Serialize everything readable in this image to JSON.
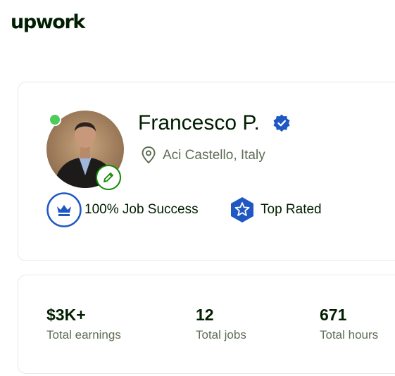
{
  "header": {
    "logo_text": "upwork"
  },
  "profile": {
    "name": "Francesco P.",
    "location": "Aci Castello, Italy",
    "online": true,
    "verified": true,
    "badges": [
      {
        "label": "100% Job Success",
        "icon": "crown-icon",
        "color": "#1f57c3"
      },
      {
        "label": "Top Rated",
        "icon": "star-icon",
        "color": "#1f57c3"
      }
    ]
  },
  "stats": [
    {
      "value": "$3K+",
      "label": "Total earnings"
    },
    {
      "value": "12",
      "label": "Total jobs"
    },
    {
      "value": "671",
      "label": "Total hours"
    }
  ],
  "colors": {
    "brand_green": "#108a00",
    "online_green": "#4dcc5c",
    "verified_blue": "#1f57c3",
    "muted_text": "#5e6d55",
    "text": "#001e00"
  }
}
